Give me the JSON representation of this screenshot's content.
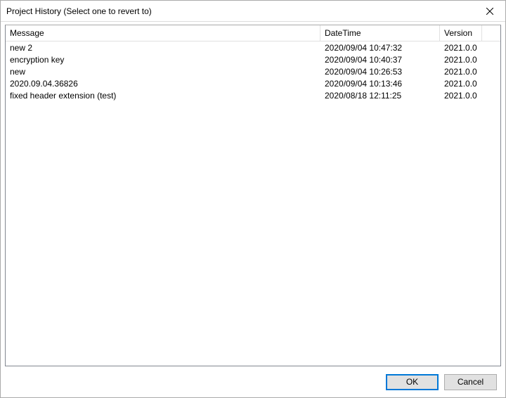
{
  "title": "Project History (Select one to revert to)",
  "columns": {
    "message": "Message",
    "datetime": "DateTime",
    "version": "Version"
  },
  "rows": [
    {
      "message": "new 2",
      "datetime": "2020/09/04 10:47:32",
      "version": "2021.0.0"
    },
    {
      "message": "encryption key",
      "datetime": "2020/09/04 10:40:37",
      "version": "2021.0.0"
    },
    {
      "message": "new",
      "datetime": "2020/09/04 10:26:53",
      "version": "2021.0.0"
    },
    {
      "message": "2020.09.04.36826",
      "datetime": "2020/09/04 10:13:46",
      "version": "2021.0.0"
    },
    {
      "message": "fixed header extension (test)",
      "datetime": "2020/08/18 12:11:25",
      "version": "2021.0.0"
    }
  ],
  "buttons": {
    "ok": "OK",
    "cancel": "Cancel"
  }
}
